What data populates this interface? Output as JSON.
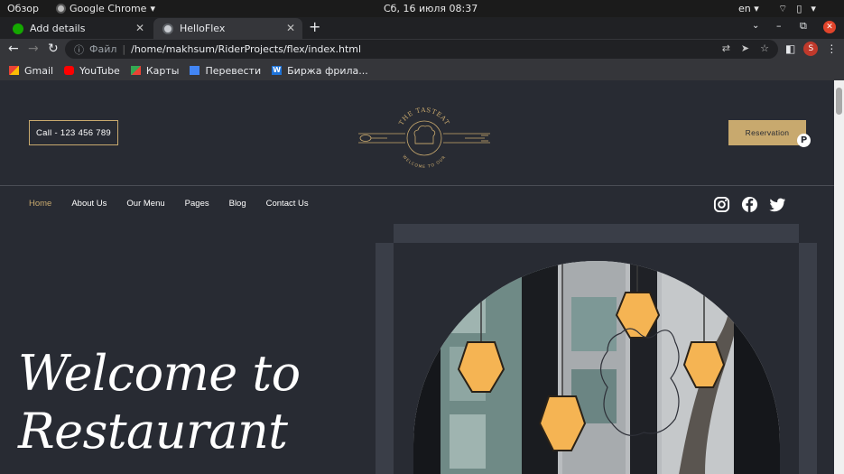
{
  "os": {
    "activities": "Обзор",
    "app": "Google Chrome",
    "clock": "Сб, 16 июля  08:37",
    "lang": "en"
  },
  "tabs": [
    {
      "label": "Add details",
      "icon": "upwork-icon"
    },
    {
      "label": "HelloFlex",
      "icon": "globe-icon"
    }
  ],
  "address": {
    "scheme_label": "Файл",
    "url": "/home/makhsum/RiderProjects/flex/index.html"
  },
  "profile_initial": "S",
  "bookmarks": [
    {
      "label": "Gmail"
    },
    {
      "label": "YouTube"
    },
    {
      "label": "Карты"
    },
    {
      "label": "Перевести"
    },
    {
      "label": "Биржа фрила..."
    }
  ],
  "site": {
    "call_label": "Call - 123 456 789",
    "reservation_label": "Reservation",
    "logo_top_text": "THE TASTEAT",
    "logo_bottom_text": "WELCOME TO OUR",
    "nav": [
      "Home",
      "About Us",
      "Our Menu",
      "Pages",
      "Blog",
      "Contact Us"
    ],
    "hero_line1": "Welcome to",
    "hero_line2": "Restaurant",
    "accent": "#c8a96e",
    "background": "#282b33"
  }
}
